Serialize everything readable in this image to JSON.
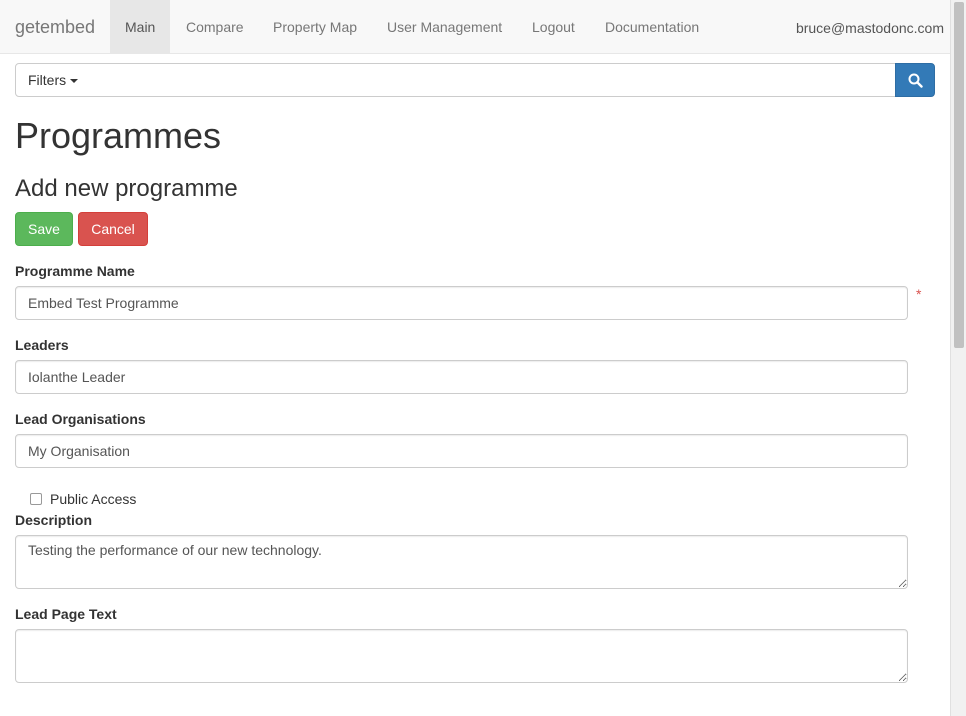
{
  "navbar": {
    "brand": "getembed",
    "items": [
      {
        "label": "Main",
        "active": true
      },
      {
        "label": "Compare"
      },
      {
        "label": "Property Map"
      },
      {
        "label": "User Management"
      },
      {
        "label": "Logout"
      },
      {
        "label": "Documentation"
      }
    ],
    "user": "bruce@mastodonc.com"
  },
  "search": {
    "filters_label": "Filters",
    "value": "",
    "placeholder": "",
    "button_icon": "search-icon"
  },
  "page": {
    "title": "Programmes",
    "subtitle": "Add new programme"
  },
  "actions": {
    "save_label": "Save",
    "cancel_label": "Cancel"
  },
  "form": {
    "programme_name": {
      "label": "Programme Name",
      "value": "Embed Test Programme",
      "required_marker": "*"
    },
    "leaders": {
      "label": "Leaders",
      "value": "Iolanthe Leader"
    },
    "lead_organisations": {
      "label": "Lead Organisations",
      "value": "My Organisation"
    },
    "public_access": {
      "label": "Public Access",
      "checked": false
    },
    "description": {
      "label": "Description",
      "value": "Testing the performance of our new technology."
    },
    "lead_page_text": {
      "label": "Lead Page Text",
      "value": ""
    }
  },
  "colors": {
    "save": "#5cb85c",
    "cancel": "#d9534f",
    "search_button": "#337ab7",
    "required": "#d9534f"
  }
}
